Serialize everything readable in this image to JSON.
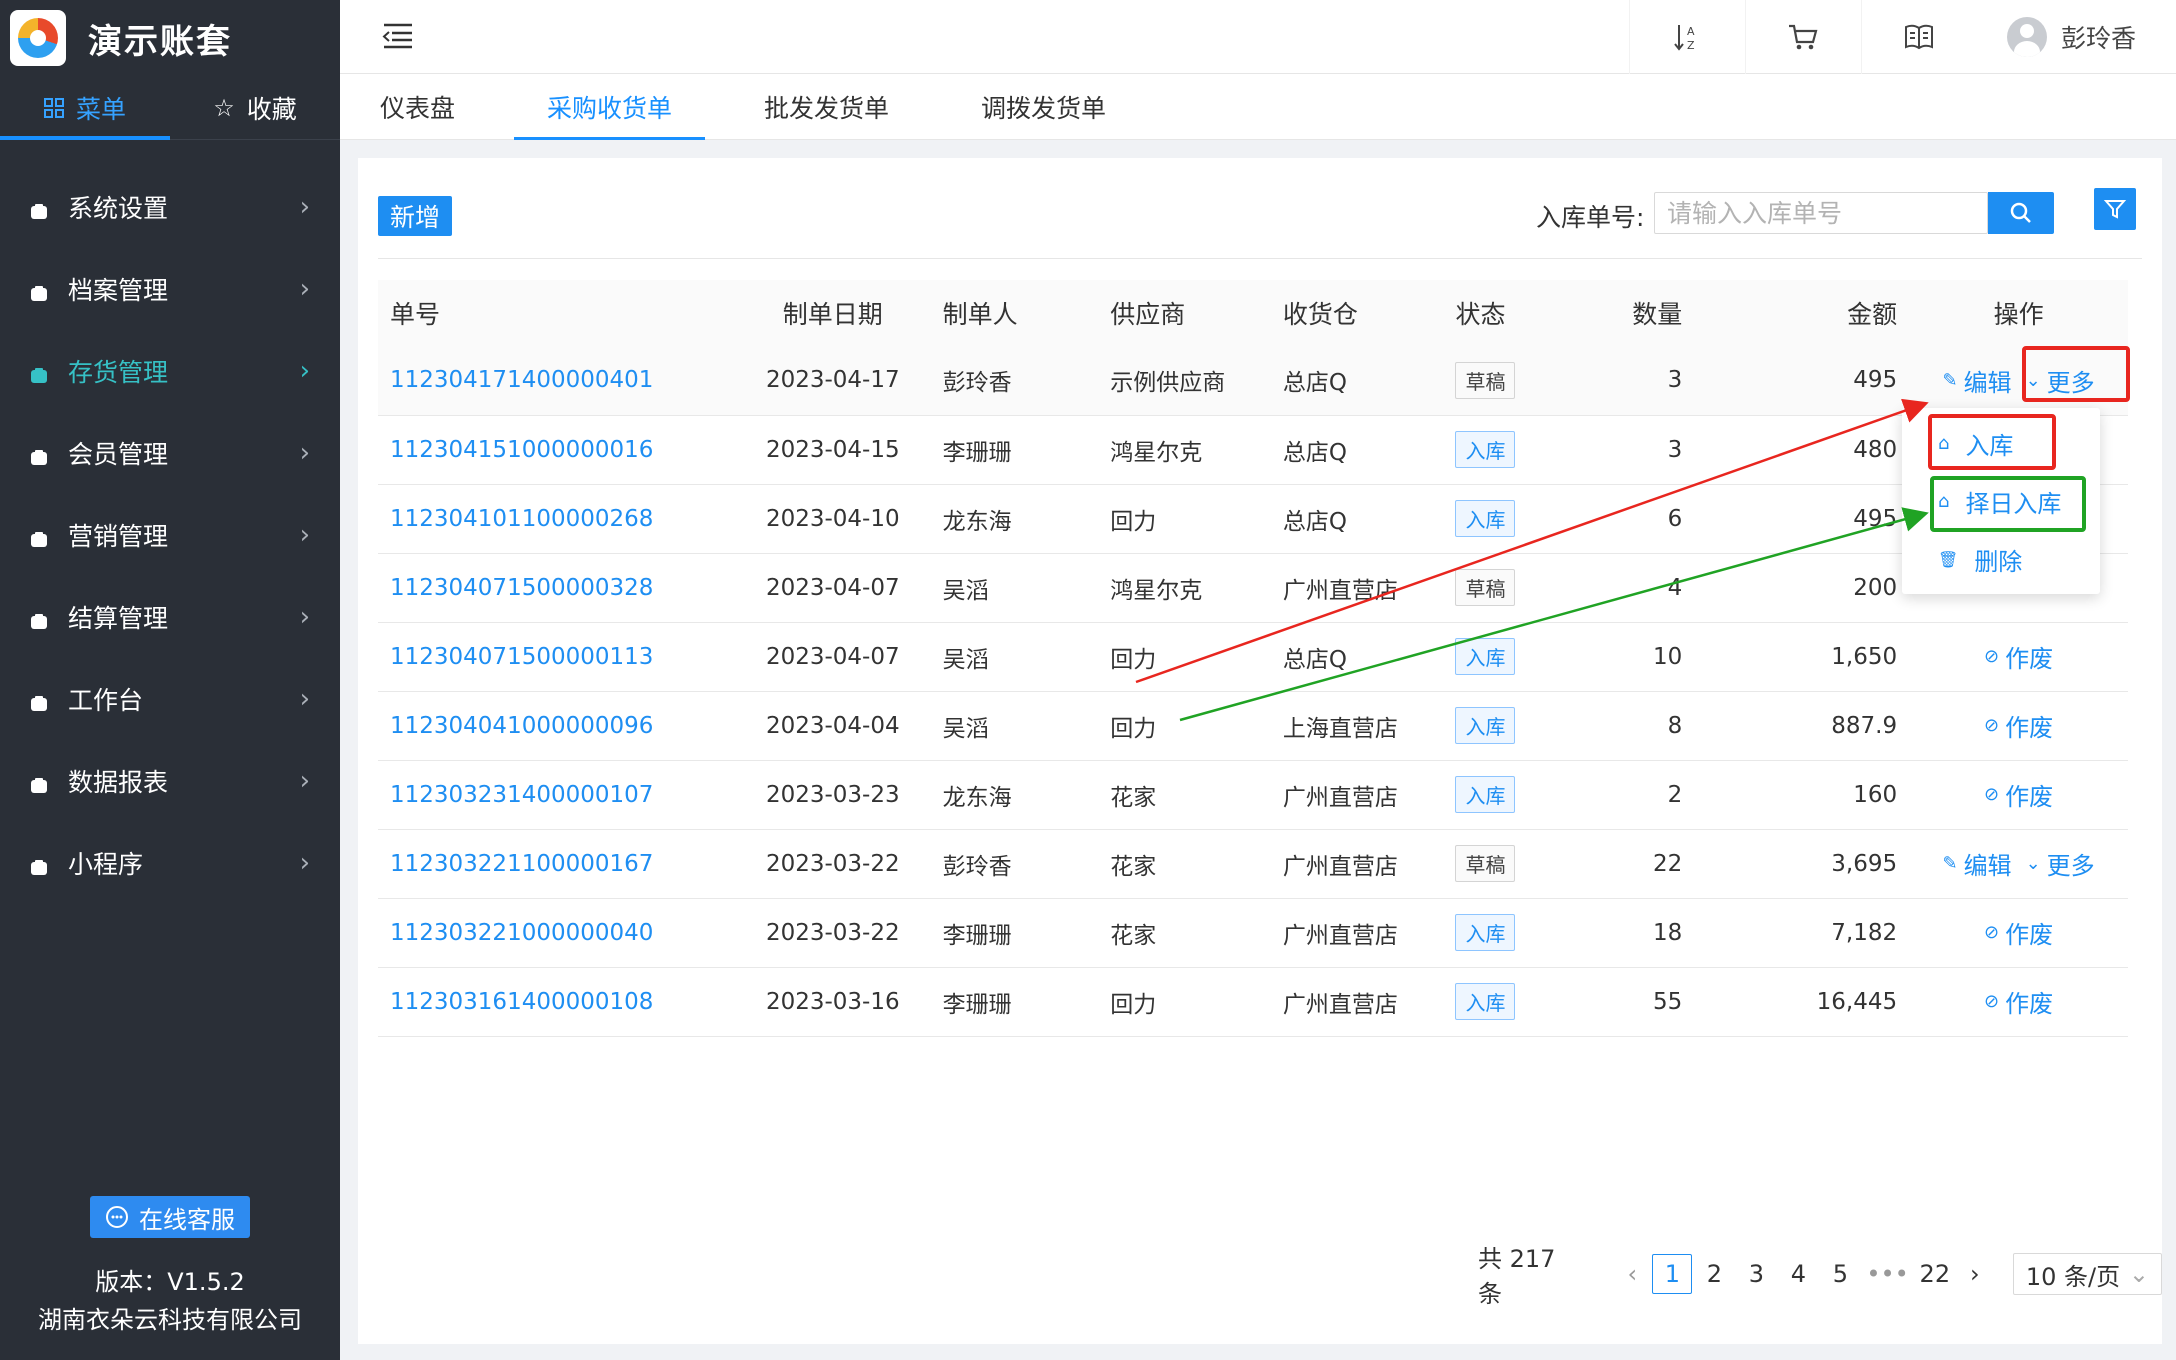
{
  "app": {
    "title": "演示账套"
  },
  "sidebar": {
    "tabs": [
      {
        "label": "菜单",
        "icon": "grid-icon"
      },
      {
        "label": "收藏",
        "icon": "star-icon"
      }
    ],
    "items": [
      {
        "label": "系统设置",
        "icon": "settings-icon"
      },
      {
        "label": "档案管理",
        "icon": "archive-icon"
      },
      {
        "label": "存货管理",
        "icon": "inventory-icon",
        "active": true
      },
      {
        "label": "会员管理",
        "icon": "member-icon"
      },
      {
        "label": "营销管理",
        "icon": "marketing-icon"
      },
      {
        "label": "结算管理",
        "icon": "settlement-icon"
      },
      {
        "label": "工作台",
        "icon": "workbench-icon"
      },
      {
        "label": "数据报表",
        "icon": "report-icon"
      },
      {
        "label": "小程序",
        "icon": "miniapp-icon"
      }
    ],
    "service_label": "在线客服",
    "version": "版本：V1.5.2",
    "company": "湖南衣朵云科技有限公司"
  },
  "topbar": {
    "user_name": "彭玲香"
  },
  "page_tabs": [
    "仪表盘",
    "采购收货单",
    "批发发货单",
    "调拨发货单"
  ],
  "active_tab": 1,
  "toolbar": {
    "add_label": "新增",
    "search_label": "入库单号:",
    "search_placeholder": "请输入入库单号"
  },
  "table": {
    "columns": [
      "单号",
      "制单日期",
      "制单人",
      "供应商",
      "收货仓",
      "状态",
      "数量",
      "金额",
      "操作"
    ],
    "rows": [
      {
        "no": "112304171400000401",
        "date": "2023-04-17",
        "maker": "彭玲香",
        "supplier": "示例供应商",
        "warehouse": "总店Q",
        "status": "草稿",
        "qty": "3",
        "amount": "495",
        "ops": [
          "编辑",
          "更多"
        ]
      },
      {
        "no": "112304151000000016",
        "date": "2023-04-15",
        "maker": "李珊珊",
        "supplier": "鸿星尔克",
        "warehouse": "总店Q",
        "status": "入库",
        "qty": "3",
        "amount": "480",
        "ops": []
      },
      {
        "no": "112304101100000268",
        "date": "2023-04-10",
        "maker": "龙东海",
        "supplier": "回力",
        "warehouse": "总店Q",
        "status": "入库",
        "qty": "6",
        "amount": "495",
        "ops": []
      },
      {
        "no": "112304071500000328",
        "date": "2023-04-07",
        "maker": "吴滔",
        "supplier": "鸿星尔克",
        "warehouse": "广州直营店",
        "status": "草稿",
        "qty": "4",
        "amount": "200",
        "ops": []
      },
      {
        "no": "112304071500000113",
        "date": "2023-04-07",
        "maker": "吴滔",
        "supplier": "回力",
        "warehouse": "总店Q",
        "status": "入库",
        "qty": "10",
        "amount": "1,650",
        "ops": [
          "作废"
        ]
      },
      {
        "no": "112304041000000096",
        "date": "2023-04-04",
        "maker": "吴滔",
        "supplier": "回力",
        "warehouse": "上海直营店",
        "status": "入库",
        "qty": "8",
        "amount": "887.9",
        "ops": [
          "作废"
        ]
      },
      {
        "no": "112303231400000107",
        "date": "2023-03-23",
        "maker": "龙东海",
        "supplier": "花家",
        "warehouse": "广州直营店",
        "status": "入库",
        "qty": "2",
        "amount": "160",
        "ops": [
          "作废"
        ]
      },
      {
        "no": "112303221100000167",
        "date": "2023-03-22",
        "maker": "彭玲香",
        "supplier": "花家",
        "warehouse": "广州直营店",
        "status": "草稿",
        "qty": "22",
        "amount": "3,695",
        "ops": [
          "编辑",
          "更多"
        ]
      },
      {
        "no": "112303221000000040",
        "date": "2023-03-22",
        "maker": "李珊珊",
        "supplier": "花家",
        "warehouse": "广州直营店",
        "status": "入库",
        "qty": "18",
        "amount": "7,182",
        "ops": [
          "作废"
        ]
      },
      {
        "no": "112303161400000108",
        "date": "2023-03-16",
        "maker": "李珊珊",
        "supplier": "回力",
        "warehouse": "广州直营店",
        "status": "入库",
        "qty": "55",
        "amount": "16,445",
        "ops": [
          "作废"
        ]
      }
    ]
  },
  "dropdown": {
    "items": [
      "入库",
      "择日入库",
      "删除"
    ]
  },
  "pagination": {
    "total": "共 217 条",
    "pages": [
      "1",
      "2",
      "3",
      "4",
      "5",
      "•••",
      "22"
    ],
    "current": "1",
    "page_size": "10 条/页"
  },
  "colors": {
    "accent": "#1e8ef2",
    "sidebar": "#2a2f37",
    "active_menu": "#36c1c6",
    "highlight_red": "#e8261f",
    "highlight_green": "#20a324"
  }
}
